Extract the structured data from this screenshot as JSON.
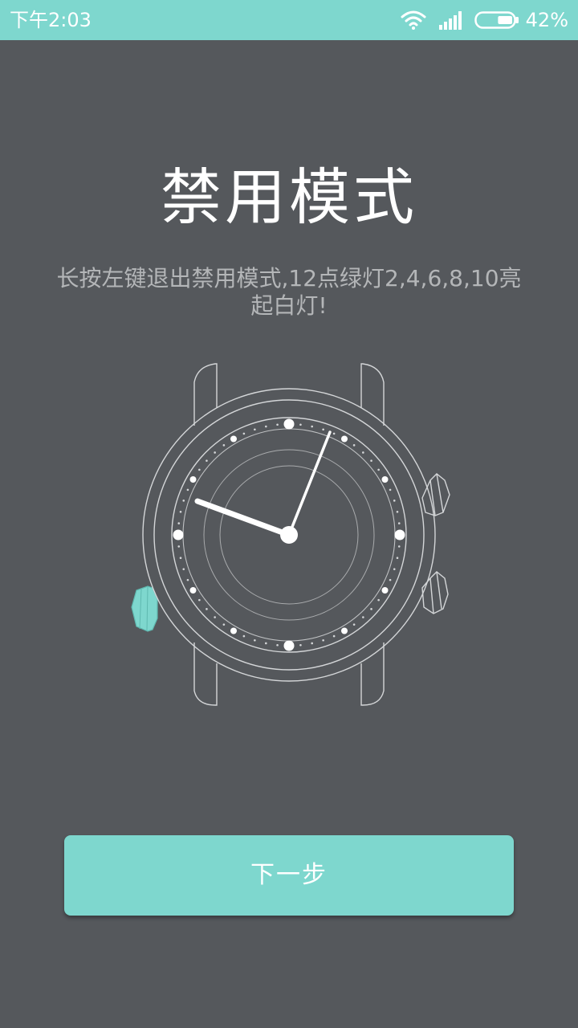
{
  "status_bar": {
    "time": "下午2:03",
    "battery_percent": "42%",
    "battery_level": 0.42,
    "icons": [
      "wifi-icon",
      "signal-icon",
      "battery-icon"
    ]
  },
  "page": {
    "title": "禁用模式",
    "description": "长按左键退出禁用模式,12点绿灯2,4,6,8,10亮起白灯!",
    "illustration": "watch-illustration"
  },
  "actions": {
    "next_label": "下一步"
  },
  "colors": {
    "accent": "#7ed7ce",
    "background": "#55585c",
    "text_primary": "#ffffff",
    "text_secondary": "#b4b6b8"
  }
}
